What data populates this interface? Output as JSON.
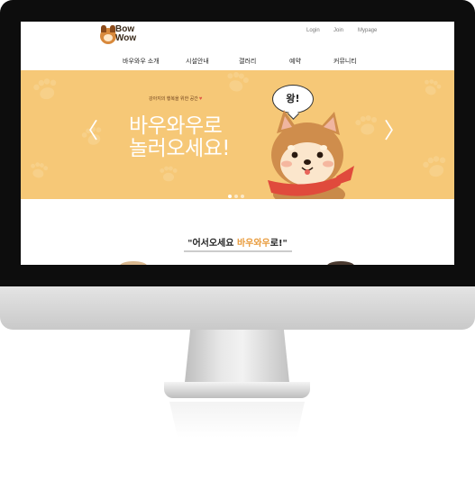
{
  "logo": {
    "line1": "Bow",
    "line2": "Wow"
  },
  "topnav": {
    "login": "Login",
    "join": "Join",
    "mypage": "Mypage"
  },
  "mainnav": [
    "바우와우 소개",
    "시설안내",
    "갤러리",
    "예약",
    "커뮤니티"
  ],
  "banner": {
    "tagline": "강아지의 행복을 위한 공간",
    "headline_line1": "바우와우로",
    "headline_line2": "놀러오세요!",
    "bubble": "왕!",
    "prev_arrow": "〈",
    "next_arrow": "〉",
    "background_color": "#f6c877",
    "slide_count": 3,
    "active_slide": 1
  },
  "welcome": {
    "prefix": "\"어서오세요 ",
    "highlight": "바우와우",
    "suffix": "로!\""
  }
}
